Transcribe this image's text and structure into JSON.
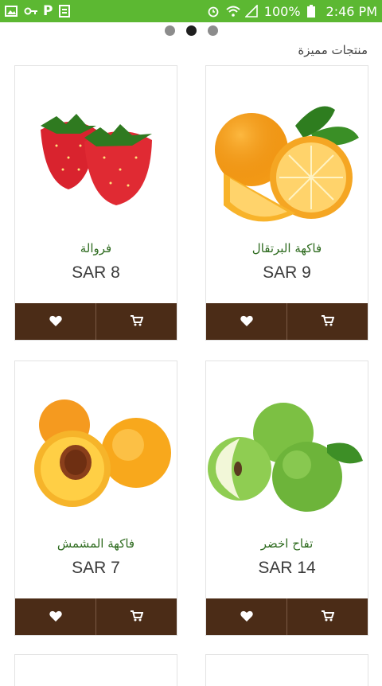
{
  "status_bar": {
    "battery": "100%",
    "time": "2:46 PM",
    "accent_color": "#5cb832"
  },
  "carousel": {
    "pages": 3,
    "active_page": 2
  },
  "section": {
    "title": "منتجات مميزة"
  },
  "products": [
    {
      "name": "فاكهة البرتقال",
      "price": "SAR 9",
      "image_icon": "orange-image"
    },
    {
      "name": "فروالة",
      "price": "SAR 8",
      "image_icon": "strawberry-image"
    },
    {
      "name": "تفاح اخضر",
      "price": "SAR 14",
      "image_icon": "green-apple-image"
    },
    {
      "name": "فاكهة المشمش",
      "price": "SAR 7",
      "image_icon": "apricot-image"
    }
  ],
  "card_actions": {
    "favorite_icon": "heart-icon",
    "cart_icon": "cart-icon",
    "bar_color": "#4b2c17"
  }
}
